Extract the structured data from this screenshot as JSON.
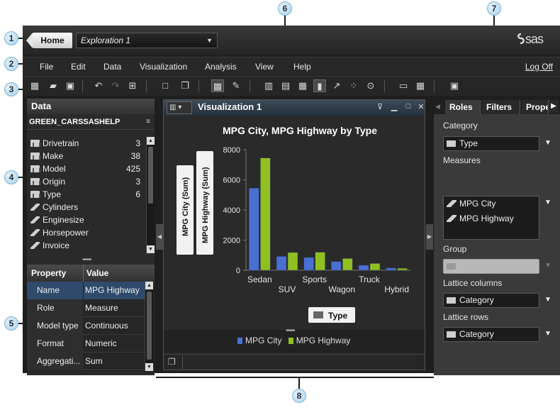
{
  "callouts": [
    "1",
    "2",
    "3",
    "4",
    "5",
    "6",
    "7",
    "8"
  ],
  "topbar": {
    "home_label": "Home",
    "exploration_value": "Exploration 1",
    "brand_logo": "sas"
  },
  "menubar": {
    "items": [
      "File",
      "Edit",
      "Data",
      "Visualization",
      "Analysis",
      "View",
      "Help"
    ],
    "logoff": "Log Off"
  },
  "toolbar": {
    "icons": [
      "new-data-icon",
      "open-icon",
      "save-icon",
      "undo-icon",
      "redo-icon",
      "new-visualization-icon",
      "window-icon",
      "cascade-icon",
      "auto-chart-icon",
      "brush-icon",
      "bar-chart-icon",
      "table-icon",
      "crosstab-icon",
      "bar-icon",
      "line-chart-icon",
      "scatter-icon",
      "bubble-icon",
      "box-plot-icon",
      "heat-map-icon",
      "geo-map-icon"
    ]
  },
  "data_panel": {
    "header": "Data",
    "source": "GREEN_CARSSASHELP",
    "items": [
      {
        "label": "Drivetrain",
        "count": "3",
        "kind": "category"
      },
      {
        "label": "Make",
        "count": "38",
        "kind": "category"
      },
      {
        "label": "Model",
        "count": "425",
        "kind": "category"
      },
      {
        "label": "Origin",
        "count": "3",
        "kind": "category"
      },
      {
        "label": "Type",
        "count": "6",
        "kind": "category"
      },
      {
        "label": "Cylinders",
        "count": "",
        "kind": "measure"
      },
      {
        "label": "Enginesize",
        "count": "",
        "kind": "measure"
      },
      {
        "label": "Horsepower",
        "count": "",
        "kind": "measure"
      },
      {
        "label": "Invoice",
        "count": "",
        "kind": "measure"
      }
    ]
  },
  "properties": {
    "col_property": "Property",
    "col_value": "Value",
    "rows": [
      {
        "key": "Name",
        "value": "MPG Highway"
      },
      {
        "key": "Role",
        "value": "Measure"
      },
      {
        "key": "Model type",
        "value": "Continuous"
      },
      {
        "key": "Format",
        "value": "Numeric"
      },
      {
        "key": "Aggregati...",
        "value": "Sum"
      }
    ]
  },
  "visualization": {
    "window_title": "Visualization 1",
    "y_axis_button_1": "MPG City (Sum)",
    "y_axis_button_2": "MPG Highway (Sum)",
    "x_axis_button": "Type",
    "legend": [
      "MPG City",
      "MPG Highway"
    ]
  },
  "chart_data": {
    "type": "bar",
    "title": "MPG City, MPG Highway by Type",
    "xlabel": "Type",
    "ylabel": "",
    "categories": [
      "Sedan",
      "SUV",
      "Sports",
      "Wagon",
      "Truck",
      "Hybrid"
    ],
    "series": [
      {
        "name": "MPG City",
        "values": [
          5450,
          920,
          850,
          580,
          330,
          150
        ],
        "color": "#4a6fd2"
      },
      {
        "name": "MPG Highway",
        "values": [
          7450,
          1180,
          1200,
          780,
          450,
          130
        ],
        "color": "#8fc020"
      }
    ],
    "ylim": [
      0,
      8000
    ],
    "yticks": [
      "0",
      "2000",
      "4000",
      "6000",
      "8000"
    ],
    "grid": false,
    "legend_position": "bottom"
  },
  "roles_panel": {
    "tabs": [
      "Roles",
      "Filters",
      "Properties"
    ],
    "category_label": "Category",
    "category_value": "Type",
    "measures_label": "Measures",
    "measures": [
      "MPG City",
      "MPG Highway"
    ],
    "group_label": "Group",
    "lattice_columns_label": "Lattice columns",
    "lattice_columns_value": "Category",
    "lattice_rows_label": "Lattice rows",
    "lattice_rows_value": "Category"
  },
  "colors": {
    "city": "#4a6fd2",
    "highway": "#8fc020",
    "selection": "#2f4a6a"
  }
}
